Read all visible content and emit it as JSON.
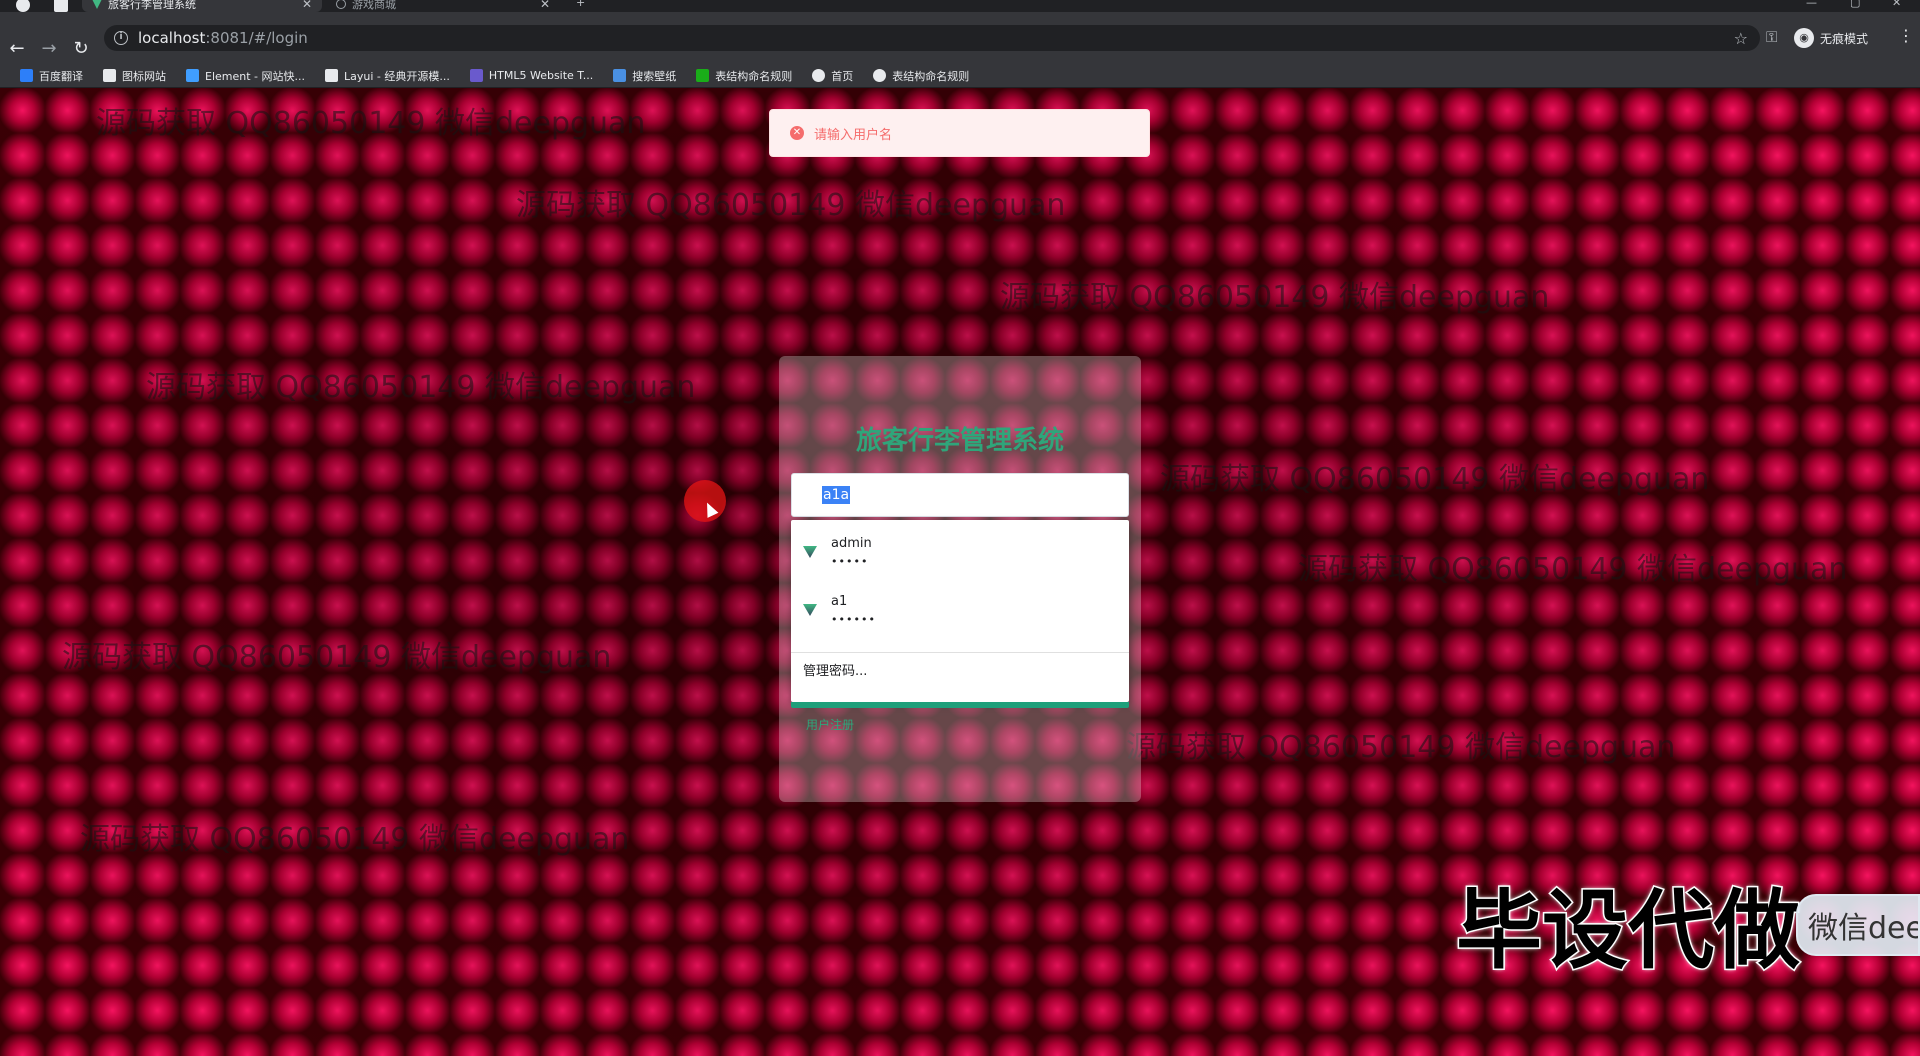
{
  "browser": {
    "tabs": [
      {
        "title": "旅客行李管理系统",
        "active": true
      },
      {
        "title": "游戏商城",
        "active": false
      }
    ],
    "new_tab": "+",
    "address": {
      "host": "localhost",
      "path": ":8081/#/login"
    },
    "incognito_label": "无痕模式",
    "bookmarks": [
      {
        "label": "百度翻译",
        "color": "#2d7ff9"
      },
      {
        "label": "图标网站",
        "color": "#e8eaed"
      },
      {
        "label": "Element - 网站快...",
        "color": "#409eff"
      },
      {
        "label": "Layui - 经典开源模...",
        "color": "#e8eaed"
      },
      {
        "label": "HTML5 Website T...",
        "color": "#6a5acd"
      },
      {
        "label": "搜索壁纸",
        "color": "#4a90e2"
      },
      {
        "label": "表结构命名规则",
        "color": "#1aad19"
      },
      {
        "label": "首页",
        "color": "#e8eaed"
      },
      {
        "label": "表结构命名规则",
        "color": "#e8eaed"
      }
    ]
  },
  "watermark_text": "源码获取 QQ86050149 微信deepguan",
  "message": {
    "text": "请输入用户名",
    "type": "error"
  },
  "login": {
    "title": "旅客行李管理系统",
    "username_value": "a1a",
    "register_link": "用户注册"
  },
  "autofill": {
    "items": [
      {
        "username": "admin",
        "password_mask": "•••••"
      },
      {
        "username": "a1",
        "password_mask": "••••••"
      }
    ],
    "manage_label": "管理密码..."
  },
  "promo": {
    "title": "毕设代做",
    "badge": "微信deepguan"
  },
  "colors": {
    "accent": "#2fa57a",
    "error": "#f56c6c",
    "autofill_bar": "#1e9f7a"
  }
}
